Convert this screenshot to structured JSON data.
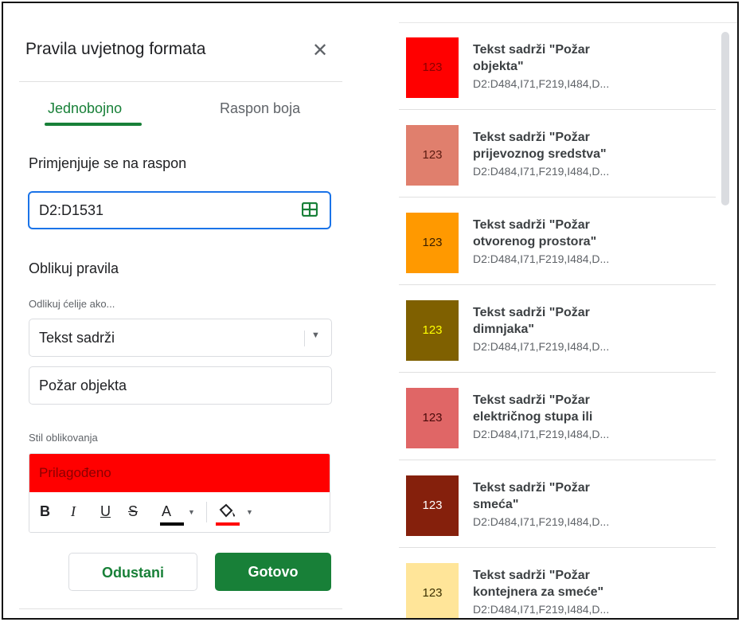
{
  "panel": {
    "title": "Pravila uvjetnog formata",
    "close_icon": "close-icon",
    "tabs": [
      {
        "label": "Jednobojno",
        "active": true
      },
      {
        "label": "Raspon boja",
        "active": false
      }
    ],
    "range_label": "Primjenjuje se na raspon",
    "range_value": "D2:D1531",
    "format_rules_label": "Oblikuj pravila",
    "condition_label": "Odlikuj ćelije ako...",
    "condition_value": "Tekst sadrži",
    "value_input": "Požar objekta",
    "style_label": "Stil oblikovanja",
    "style_preview": "Prilagođeno",
    "style_preview_color": "#ff0000",
    "toolbar": {
      "bold": "B",
      "italic": "I",
      "underline": "U",
      "strike": "S",
      "text_color": "A",
      "text_color_value": "#000000",
      "fill_color_value": "#ff0000"
    },
    "cancel_label": "Odustani",
    "done_label": "Gotovo",
    "accent_color": "#188038"
  },
  "rules": [
    {
      "line1": "Tekst sadrži \"Požar",
      "line2": "objekta\"",
      "range": "D2:D484,I71,F219,I484,D...",
      "swatch_text": "123",
      "bg": "#ff0000",
      "fg": "#8b0000"
    },
    {
      "line1": "Tekst sadrži \"Požar",
      "line2": "prijevoznog sredstva\"",
      "range": "D2:D484,I71,F219,I484,D...",
      "swatch_text": "123",
      "bg": "#e07f6d",
      "fg": "#5a1a10"
    },
    {
      "line1": "Tekst sadrži \"Požar",
      "line2": "otvorenog prostora\"",
      "range": "D2:D484,I71,F219,I484,D...",
      "swatch_text": "123",
      "bg": "#ff9900",
      "fg": "#3c2000"
    },
    {
      "line1": "Tekst sadrži \"Požar",
      "line2": "dimnjaka\"",
      "range": "D2:D484,I71,F219,I484,D...",
      "swatch_text": "123",
      "bg": "#7f6000",
      "fg": "#ffff00"
    },
    {
      "line1": "Tekst sadrži \"Požar",
      "line2": "električnog stupa ili",
      "range": "D2:D484,I71,F219,I484,D...",
      "swatch_text": "123",
      "bg": "#e06666",
      "fg": "#4a0a0a"
    },
    {
      "line1": "Tekst sadrži \"Požar",
      "line2": "smeća\"",
      "range": "D2:D484,I71,F219,I484,D...",
      "swatch_text": "123",
      "bg": "#85200c",
      "fg": "#ffffff"
    },
    {
      "line1": "Tekst sadrži \"Požar",
      "line2": "kontejnera za smeće\"",
      "range": "D2:D484,I71,F219,I484,D...",
      "swatch_text": "123",
      "bg": "#ffe599",
      "fg": "#3c3000"
    }
  ]
}
